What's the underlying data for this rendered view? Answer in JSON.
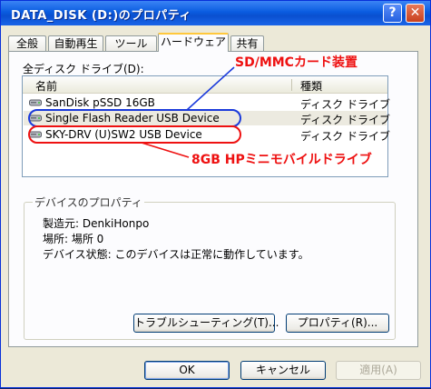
{
  "window": {
    "title": "DATA_DISK (D:)のプロパティ",
    "help_glyph": "?",
    "close_glyph": "✕"
  },
  "tabs": [
    {
      "label": "全般"
    },
    {
      "label": "自動再生"
    },
    {
      "label": "ツール"
    },
    {
      "label": "ハードウェア"
    },
    {
      "label": "共有"
    }
  ],
  "active_tab": "ハードウェア",
  "device_list": {
    "label": "全ディスク ドライブ(D):",
    "columns": [
      "名前",
      "種類"
    ],
    "rows": [
      {
        "name": "SanDisk pSSD 16GB",
        "type": "ディスク ドライブ"
      },
      {
        "name": "Single Flash Reader USB Device",
        "type": "ディスク ドライブ"
      },
      {
        "name": "SKY-DRV (U)SW2 USB Device",
        "type": "ディスク ドライブ"
      }
    ]
  },
  "properties": {
    "group_title": "デバイスのプロパティ",
    "manufacturer": "製造元: DenkiHonpo",
    "location": "場所: 場所 0",
    "status": "デバイス状態: このデバイスは正常に動作しています。",
    "troubleshoot_button": "トラブルシューティング(T)...",
    "properties_button": "プロパティ(R)..."
  },
  "buttons": {
    "ok": "OK",
    "cancel": "キャンセル",
    "apply": "適用(A)"
  },
  "annotations": {
    "sdmmc": "SD/MMCカード装置",
    "hp_mini": "8GB HPミニモバイルドライブ",
    "blue_color": "#1a3adb",
    "red_color": "#ee1111"
  },
  "icons": {
    "drive": "hard-drive-icon",
    "window": "properties-window-icon"
  }
}
